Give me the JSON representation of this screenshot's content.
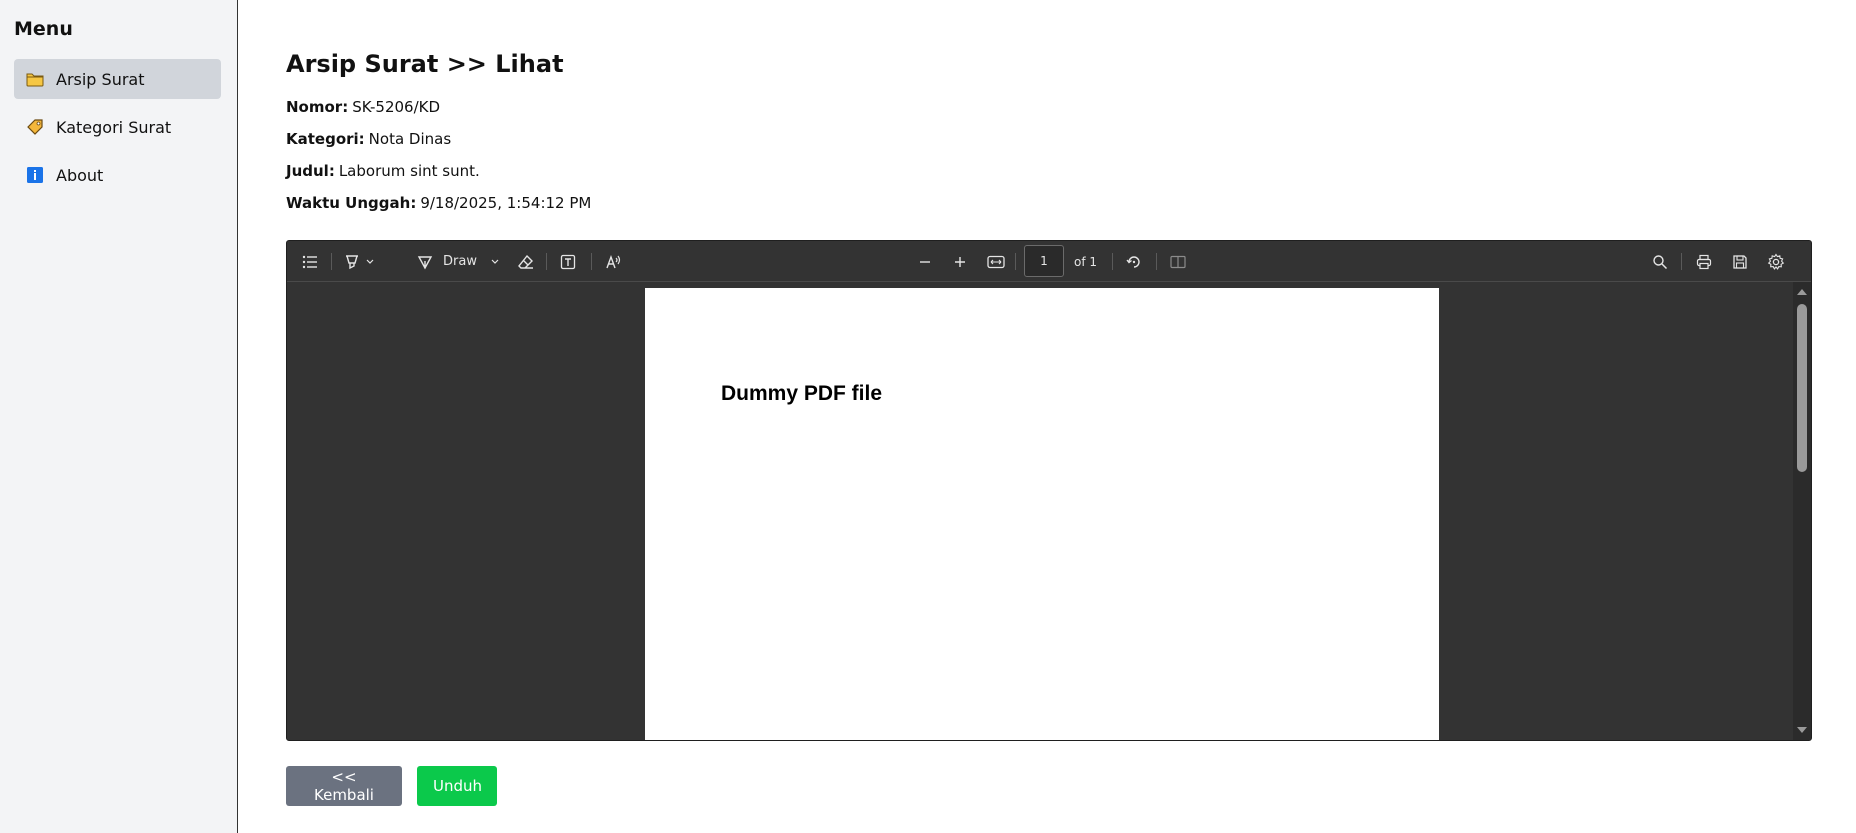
{
  "sidebar": {
    "title": "Menu",
    "items": [
      {
        "label": "Arsip Surat",
        "icon": "folder-icon",
        "active": true
      },
      {
        "label": "Kategori Surat",
        "icon": "tag-icon",
        "active": false
      },
      {
        "label": "About",
        "icon": "info-icon",
        "active": false
      }
    ]
  },
  "main": {
    "title": "Arsip Surat >> Lihat",
    "meta": [
      {
        "label": "Nomor:",
        "value": "SK-5206/KD"
      },
      {
        "label": "Kategori:",
        "value": "Nota Dinas"
      },
      {
        "label": "Judul:",
        "value": "Laborum sint sunt."
      },
      {
        "label": "Waktu Unggah:",
        "value": "9/18/2025, 1:54:12 PM"
      }
    ]
  },
  "viewer": {
    "toolbar": {
      "draw_label": "Draw",
      "page_value": "1",
      "page_of": "of 1"
    },
    "pdf": {
      "heading": "Dummy PDF file"
    }
  },
  "actions": {
    "back_label": "<< Kembali",
    "download_label": "Unduh"
  },
  "colors": {
    "sidebar_bg": "#f3f4f6",
    "active_item_bg": "#d1d5db",
    "viewer_bg": "#333333",
    "back_button": "#6b7280",
    "download_button": "#0bc94b"
  }
}
